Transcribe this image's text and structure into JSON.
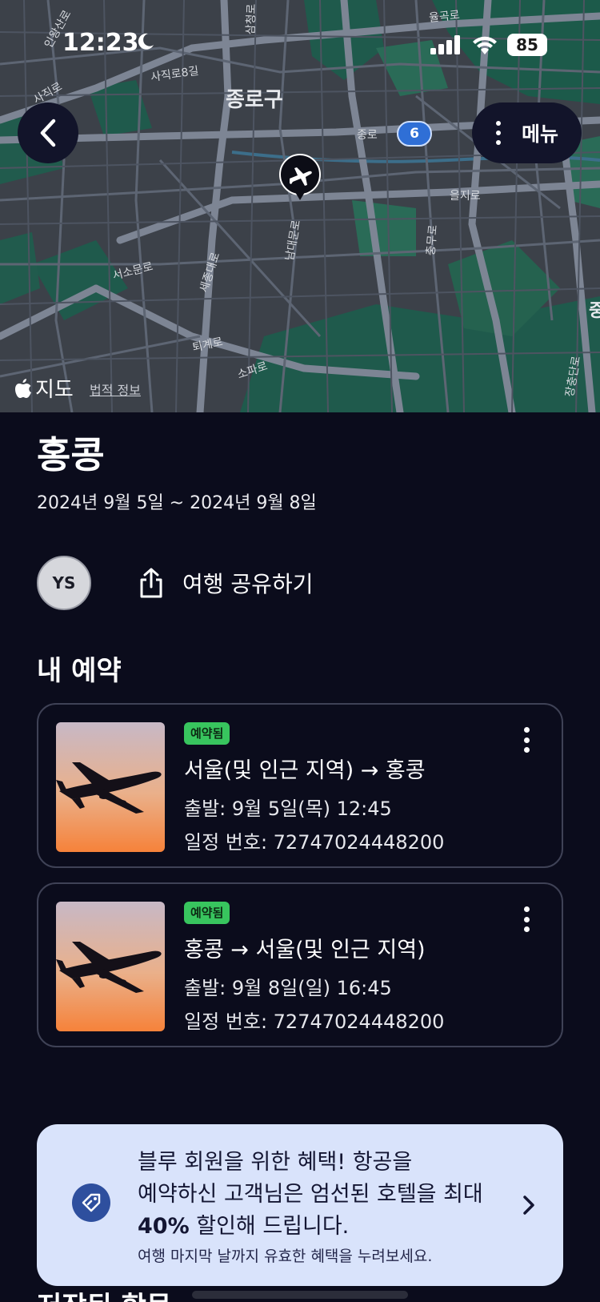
{
  "status_bar": {
    "time": "12:23",
    "battery": "85"
  },
  "map": {
    "labels": {
      "district": "종로구",
      "jongno": "종로",
      "euljiro": "을지로",
      "sajikro": "사직로8길",
      "seosomunro": "서소문로",
      "toegyero": "퇴계로",
      "sopaero": "소파로",
      "sejongdaero": "세종대로",
      "namdaemunro": "남대문로",
      "chungmuro": "충무로",
      "yulgokro": "율곡로",
      "sajik": "사직로",
      "jung": "중",
      "jangchungdan": "장충단로",
      "samcheong": "삼청로",
      "inwang": "인왕산로"
    },
    "route_number": "6",
    "attribution": "지도",
    "legal": "법적 정보"
  },
  "nav": {
    "menu_label": "메뉴"
  },
  "trip": {
    "title": "홍콩",
    "dates": "2024년 9월 5일 ~ 2024년 9월 8일",
    "avatar_initials": "YS",
    "share_label": "여행 공유하기"
  },
  "reservations": {
    "section_title": "내 예약",
    "items": [
      {
        "badge": "예약됨",
        "route": "서울(및 인근 지역) → 홍콩",
        "departure": "출발: 9월 5일(목) 12:45",
        "itinerary": "일정 번호: 72747024448200"
      },
      {
        "badge": "예약됨",
        "route": "홍콩 → 서울(및 인근 지역)",
        "departure": "출발: 9월 8일(일) 16:45",
        "itinerary": "일정 번호: 72747024448200"
      }
    ]
  },
  "promo": {
    "line1": "블루 회원을 위한 혜택! 항공을",
    "line2": "예약하신 고객님은 엄선된 호텔을 최대",
    "highlight": "40%",
    "line3_rest": " 할인해 드립니다.",
    "sub": "여행 마지막 날까지 유효한 혜택을 누려보세요."
  },
  "next_section_title": "저장된 항목"
}
